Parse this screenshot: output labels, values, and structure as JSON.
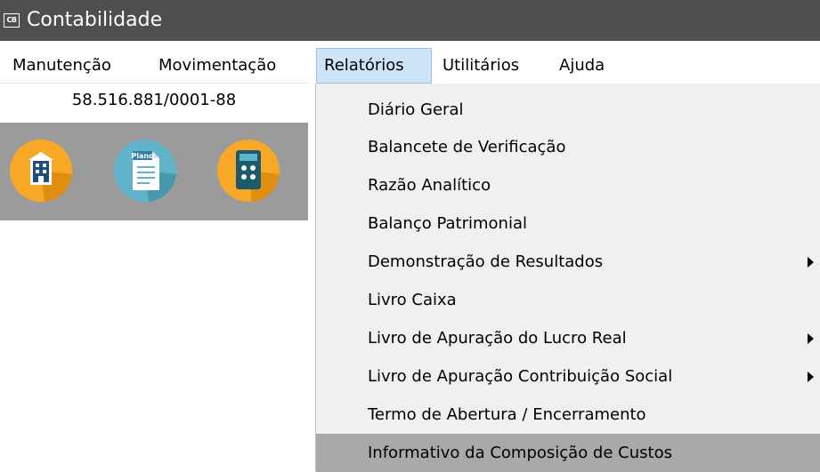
{
  "window": {
    "title": "Contabilidade",
    "icon_text": "CB"
  },
  "menubar": [
    {
      "label": "Manutenção"
    },
    {
      "label": "Movimentação"
    },
    {
      "label": "Relatórios",
      "active": true
    },
    {
      "label": "Utilitários"
    },
    {
      "label": "Ajuda"
    }
  ],
  "company": {
    "cnpj": "58.516.881/0001-88"
  },
  "toolbar": {
    "buttons": [
      {
        "icon": "building-icon"
      },
      {
        "icon": "plano-document-icon",
        "text": "Plano"
      },
      {
        "icon": "calculator-icon"
      }
    ]
  },
  "relatorios_menu": [
    {
      "label": "Diário Geral",
      "submenu": false
    },
    {
      "label": "Balancete de Verificação",
      "submenu": false
    },
    {
      "label": "Razão Analítico",
      "submenu": false
    },
    {
      "label": "Balanço Patrimonial",
      "submenu": false
    },
    {
      "label": "Demonstração de Resultados",
      "submenu": true
    },
    {
      "label": "Livro Caixa",
      "submenu": false
    },
    {
      "label": "Livro de Apuração do Lucro Real",
      "submenu": true
    },
    {
      "label": "Livro de Apuração Contribuição Social",
      "submenu": true
    },
    {
      "label": "Termo de Abertura / Encerramento",
      "submenu": false
    },
    {
      "label": "Informativo da Composição de Custos",
      "submenu": false,
      "highlighted": true
    }
  ],
  "colors": {
    "titlebar": "#4f4f4f",
    "toolbar_bg": "#9b9b9b",
    "orange": "#f7a826",
    "teal": "#5fb4c9",
    "highlight": "#a9a9a9"
  }
}
